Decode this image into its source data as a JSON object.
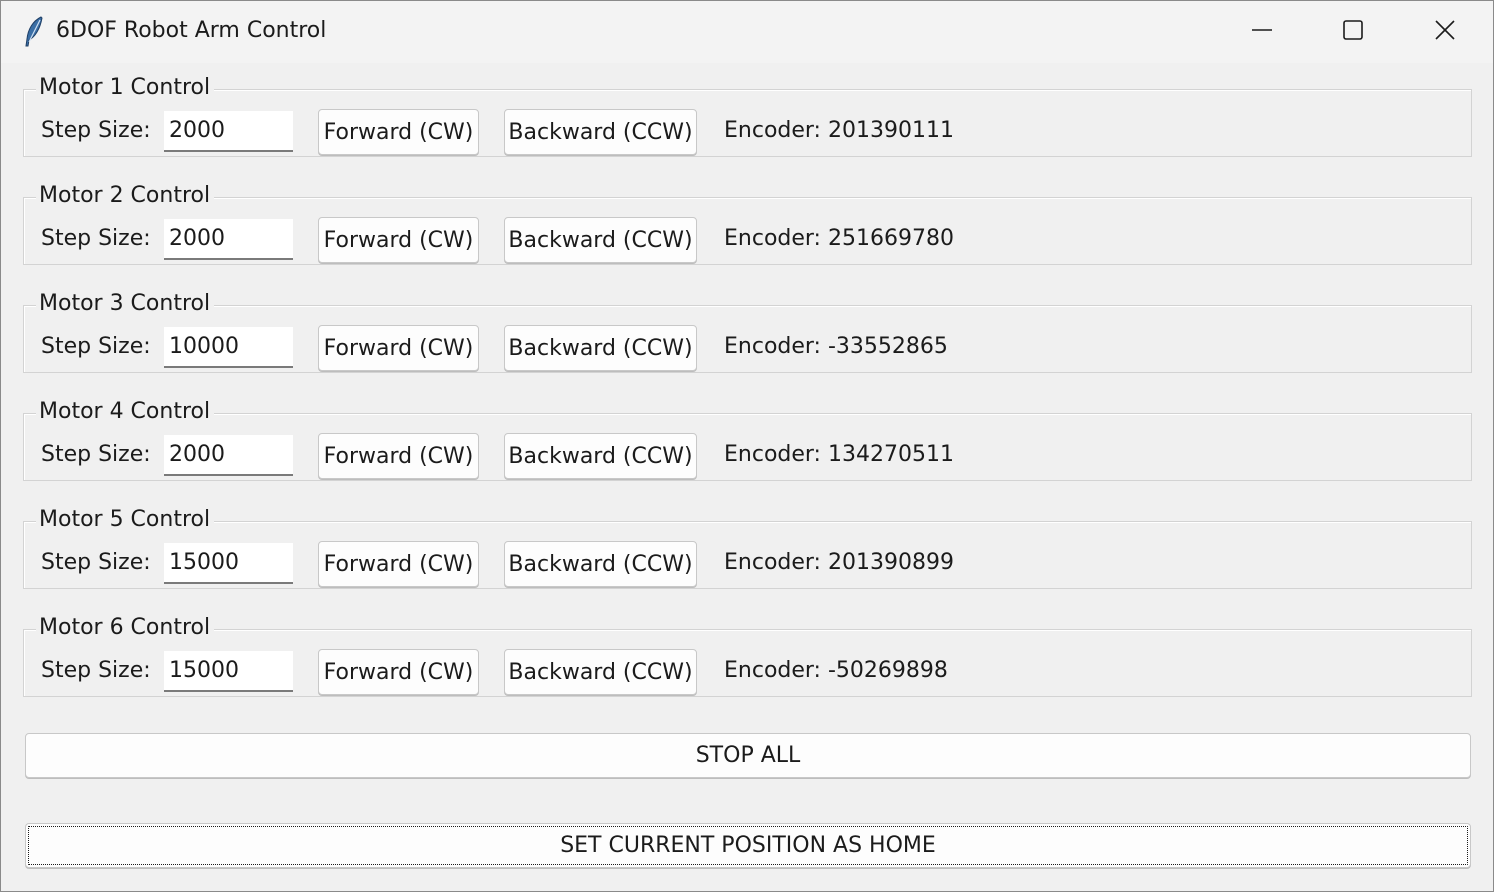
{
  "window": {
    "title": "6DOF Robot Arm Control",
    "app_icon": "feather-icon",
    "controls": [
      "minimize-icon",
      "maximize-icon",
      "close-icon"
    ]
  },
  "motors": [
    {
      "legend": "Motor 1 Control",
      "step_label": "Step Size:",
      "step_value": "2000",
      "forward_label": "Forward (CW)",
      "backward_label": "Backward (CCW)",
      "encoder": "Encoder: 201390111"
    },
    {
      "legend": "Motor 2 Control",
      "step_label": "Step Size:",
      "step_value": "2000",
      "forward_label": "Forward (CW)",
      "backward_label": "Backward (CCW)",
      "encoder": "Encoder: 251669780"
    },
    {
      "legend": "Motor 3 Control",
      "step_label": "Step Size:",
      "step_value": "10000",
      "forward_label": "Forward (CW)",
      "backward_label": "Backward (CCW)",
      "encoder": "Encoder: -33552865"
    },
    {
      "legend": "Motor 4 Control",
      "step_label": "Step Size:",
      "step_value": "2000",
      "forward_label": "Forward (CW)",
      "backward_label": "Backward (CCW)",
      "encoder": "Encoder: 134270511"
    },
    {
      "legend": "Motor 5 Control",
      "step_label": "Step Size:",
      "step_value": "15000",
      "forward_label": "Forward (CW)",
      "backward_label": "Backward (CCW)",
      "encoder": "Encoder: 201390899"
    },
    {
      "legend": "Motor 6 Control",
      "step_label": "Step Size:",
      "step_value": "15000",
      "forward_label": "Forward (CW)",
      "backward_label": "Backward (CCW)",
      "encoder": "Encoder: -50269898"
    }
  ],
  "actions": {
    "stop_all_label": "STOP ALL",
    "set_home_label": "SET CURRENT POSITION AS HOME"
  }
}
